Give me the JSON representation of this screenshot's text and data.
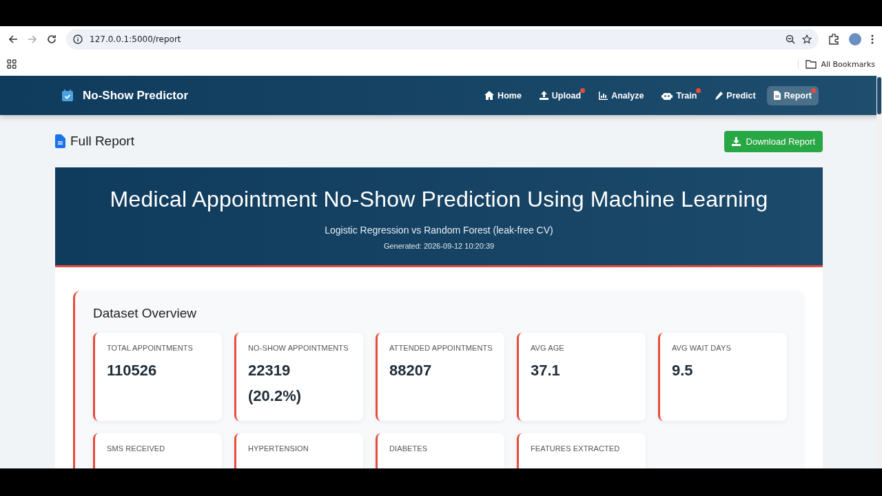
{
  "browser": {
    "url": "127.0.0.1:5000/report",
    "bookmarks_label": "All Bookmarks"
  },
  "navbar": {
    "brand": "No-Show Predictor",
    "items": [
      {
        "label": "Home",
        "badge": false,
        "selected": false
      },
      {
        "label": "Upload",
        "badge": true,
        "selected": false
      },
      {
        "label": "Analyze",
        "badge": false,
        "selected": false
      },
      {
        "label": "Train",
        "badge": true,
        "selected": false
      },
      {
        "label": "Predict",
        "badge": false,
        "selected": false
      },
      {
        "label": "Report",
        "badge": true,
        "selected": true
      }
    ]
  },
  "page": {
    "title": "Full Report",
    "download_button": "Download Report"
  },
  "banner": {
    "title": "Medical Appointment No-Show Prediction Using Machine Learning",
    "subtitle": "Logistic Regression vs Random Forest (leak-free CV)",
    "generated": "Generated: 2026-09-12 10:20:39"
  },
  "dataset_overview": {
    "heading": "Dataset Overview",
    "stats": [
      {
        "label": "TOTAL APPOINTMENTS",
        "value": "110526"
      },
      {
        "label": "NO-SHOW APPOINTMENTS",
        "value": "22319 (20.2%)"
      },
      {
        "label": "ATTENDED APPOINTMENTS",
        "value": "88207"
      },
      {
        "label": "AVG AGE",
        "value": "37.1"
      },
      {
        "label": "AVG WAIT DAYS",
        "value": "9.5"
      },
      {
        "label": "SMS RECEIVED"
      },
      {
        "label": "HYPERTENSION"
      },
      {
        "label": "DIABETES"
      },
      {
        "label": "FEATURES EXTRACTED"
      }
    ]
  }
}
